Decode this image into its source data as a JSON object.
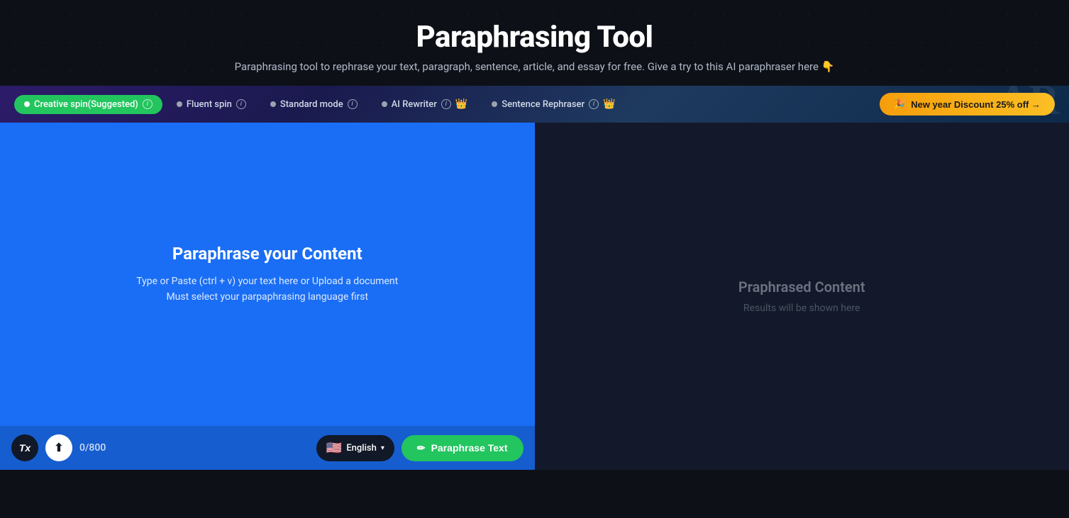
{
  "header": {
    "title": "Paraphrasing Tool",
    "subtitle": "Paraphrasing tool to rephrase your text, paragraph, sentence, article, and essay for free. Give a try to this AI paraphraser here 👇"
  },
  "modes": [
    {
      "id": "creative-spin",
      "label": "Creative spin(Suggested)",
      "active": true,
      "premium": false,
      "info": true
    },
    {
      "id": "fluent-spin",
      "label": "Fluent spin",
      "active": false,
      "premium": false,
      "info": true
    },
    {
      "id": "standard-mode",
      "label": "Standard mode",
      "active": false,
      "premium": false,
      "info": true
    },
    {
      "id": "ai-rewriter",
      "label": "AI Rewriter",
      "active": false,
      "premium": true,
      "info": true
    },
    {
      "id": "sentence-rephraser",
      "label": "Sentence Rephraser",
      "active": false,
      "premium": true,
      "info": true
    }
  ],
  "discount": {
    "label": "New year Discount 25% off →",
    "emoji": "🎉"
  },
  "left_panel": {
    "title": "Paraphrase your Content",
    "hint_line1": "Type or Paste (ctrl + v) your text here or Upload a document",
    "hint_line2": "Must select your parpaphrasing language first",
    "char_count": "0/800",
    "language": "English",
    "paraphrase_btn": "Paraphrase Text"
  },
  "right_panel": {
    "title": "Praphrased Content",
    "subtitle": "Results will be shown here"
  },
  "icons": {
    "tx": "Tx",
    "upload": "⬆",
    "pencil": "✏",
    "flag": "🇺🇸",
    "crown": "👑",
    "party": "🎉"
  }
}
